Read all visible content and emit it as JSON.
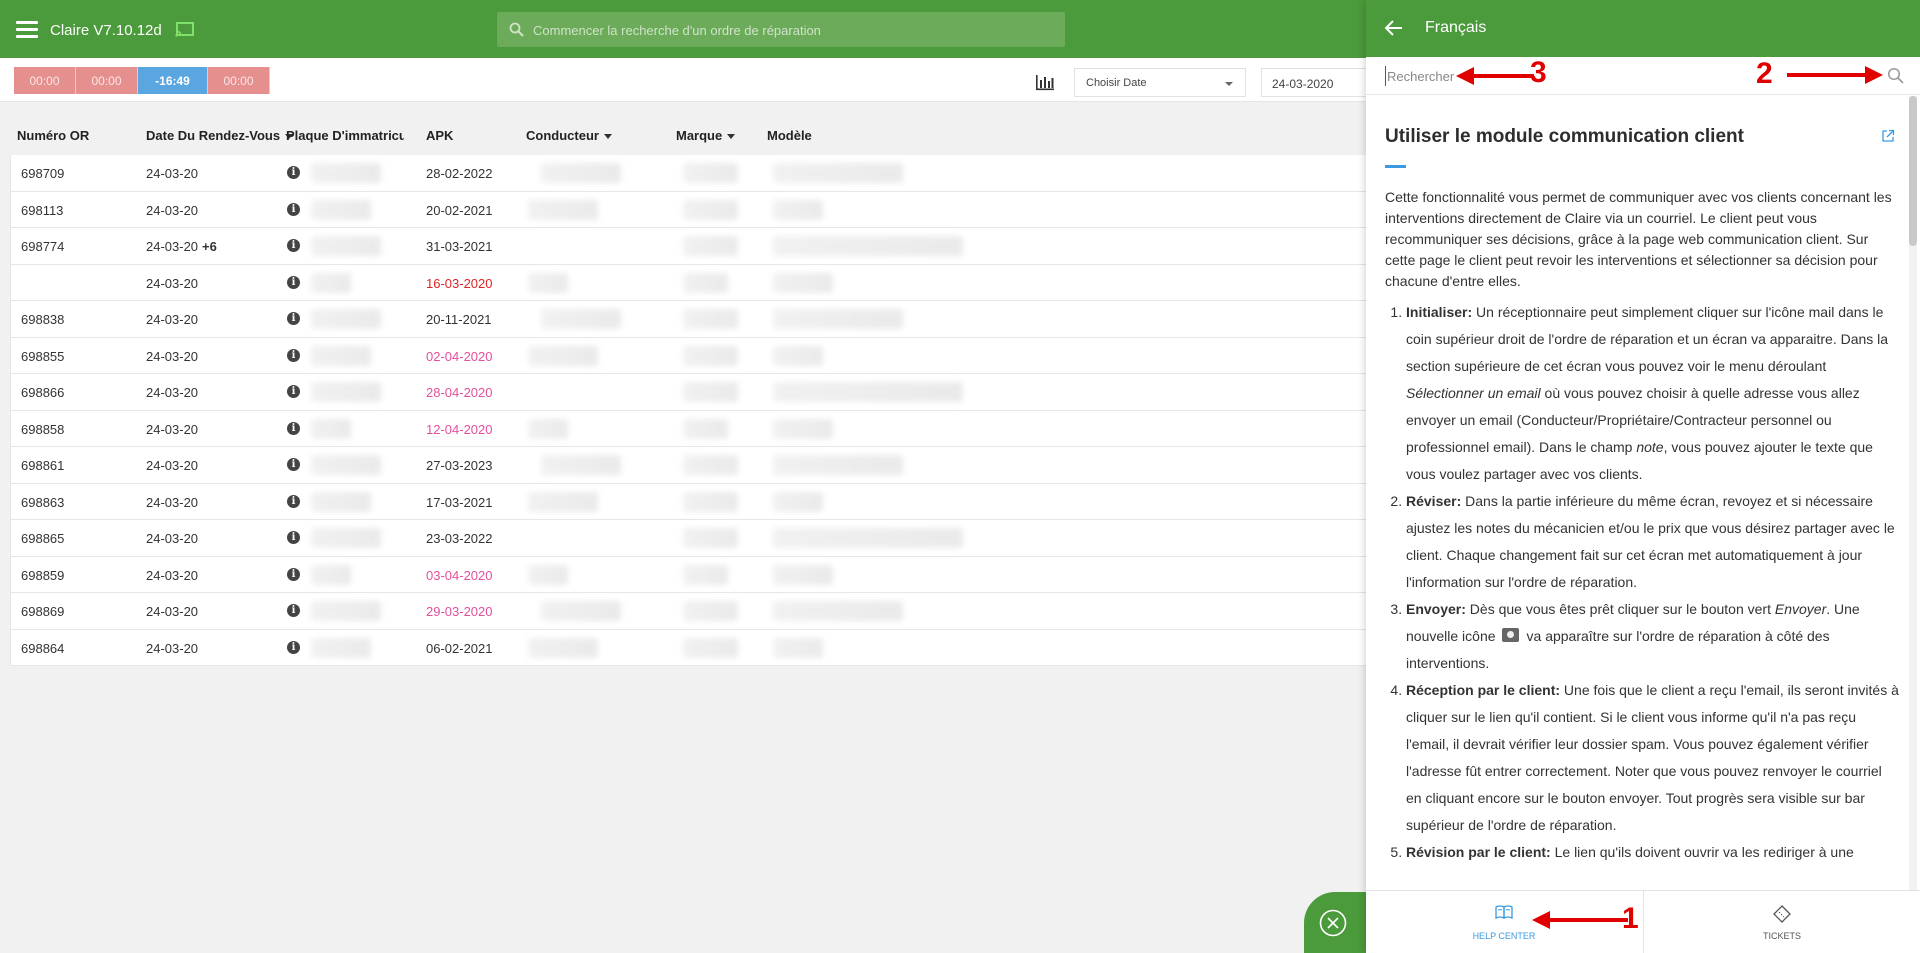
{
  "header": {
    "app_title": "Claire V7.10.12d",
    "search_placeholder": "Commencer la recherche d'un ordre de réparation"
  },
  "toolbar": {
    "timers": [
      "00:00",
      "00:00",
      "-16:49",
      "00:00"
    ],
    "date_select_label": "Choisir Date",
    "date_value": "24-03-2020"
  },
  "table": {
    "columns": [
      "Numéro OR",
      "Date Du Rendez-Vous",
      "Plaque D'immatriculation",
      "APK",
      "Conducteur",
      "Marque",
      "Modèle"
    ],
    "rows": [
      {
        "or": "698709",
        "date": "24-03-20",
        "extra": "",
        "apk": "28-02-2022",
        "apk_color": "normal"
      },
      {
        "or": "698113",
        "date": "24-03-20",
        "extra": "",
        "apk": "20-02-2021",
        "apk_color": "normal"
      },
      {
        "or": "698774",
        "date": "24-03-20",
        "extra": "+6",
        "apk": "31-03-2021",
        "apk_color": "normal"
      },
      {
        "or": "",
        "date": "24-03-20",
        "extra": "",
        "apk": "16-03-2020",
        "apk_color": "red"
      },
      {
        "or": "698838",
        "date": "24-03-20",
        "extra": "",
        "apk": "20-11-2021",
        "apk_color": "normal"
      },
      {
        "or": "698855",
        "date": "24-03-20",
        "extra": "",
        "apk": "02-04-2020",
        "apk_color": "pink"
      },
      {
        "or": "698866",
        "date": "24-03-20",
        "extra": "",
        "apk": "28-04-2020",
        "apk_color": "pink"
      },
      {
        "or": "698858",
        "date": "24-03-20",
        "extra": "",
        "apk": "12-04-2020",
        "apk_color": "pink"
      },
      {
        "or": "698861",
        "date": "24-03-20",
        "extra": "",
        "apk": "27-03-2023",
        "apk_color": "normal"
      },
      {
        "or": "698863",
        "date": "24-03-20",
        "extra": "",
        "apk": "17-03-2021",
        "apk_color": "normal"
      },
      {
        "or": "698865",
        "date": "24-03-20",
        "extra": "",
        "apk": "23-03-2022",
        "apk_color": "normal"
      },
      {
        "or": "698859",
        "date": "24-03-20",
        "extra": "",
        "apk": "03-04-2020",
        "apk_color": "pink"
      },
      {
        "or": "698869",
        "date": "24-03-20",
        "extra": "",
        "apk": "29-03-2020",
        "apk_color": "pink"
      },
      {
        "or": "698864",
        "date": "24-03-20",
        "extra": "",
        "apk": "06-02-2021",
        "apk_color": "normal"
      }
    ]
  },
  "help_panel": {
    "language": "Français",
    "search_placeholder": "Rechercher",
    "article_title": "Utiliser le module communication client",
    "intro": "Cette fonctionnalité vous permet de communiquer avec vos clients  concernant les interventions directement de Claire via un courriel. Le client peut vous recommuniquer ses décisions, grâce à la page web communication client. Sur cette page le client peut revoir les interventions et sélectionner sa décision pour chacune d'entre elles.",
    "steps": [
      {
        "title": "Initialiser:",
        "t1": " Un réceptionnaire peut simplement cliquer sur l'icône mail dans le coin supérieur droit de l'ordre de réparation et un écran va apparaitre. Dans la section supérieure de cet écran vous pouvez voir le menu déroulant ",
        "em1": "Sélectionner un email",
        "t2": " où vous pouvez choisir à quelle adresse vous allez envoyer un email (Conducteur/Propriétaire/Contracteur personnel ou professionnel email). Dans le champ ",
        "em2": "note",
        "t3": ", vous pouvez ajouter le texte que vous voulez partager avec vos clients."
      },
      {
        "title": "Réviser:",
        "t1": " Dans la partie inférieure du même écran, revoyez et si nécessaire ajustez les notes du mécanicien et/ou le prix que vous désirez partager avec le client. Chaque changement fait sur cet écran met automatiquement à jour l'information sur l'ordre de réparation."
      },
      {
        "title": "Envoyer:",
        "t1": " Dès que vous êtes prêt cliquer sur le bouton vert ",
        "em1": "Envoyer",
        "t2": ". Une nouvelle icône",
        "t3": "va apparaître sur l'ordre de réparation à côté des interventions."
      },
      {
        "title": "Réception par le client:",
        "t1": " Une fois que le client a reçu l'email, ils seront invités à cliquer sur le lien qu'il contient. Si le client vous informe qu'il n'a pas reçu l'email, il devrait vérifier leur dossier spam. Vous pouvez également vérifier l'adresse fût entrer correctement. Noter que vous pouvez renvoyer le courriel en cliquant encore sur le bouton envoyer. Tout progrès sera visible sur bar supérieur de l'ordre de réparation."
      },
      {
        "title": "Révision par le client:",
        "t1": " Le lien qu'ils doivent ouvrir va les rediriger à une"
      }
    ],
    "tabs": {
      "help": "HELP CENTER",
      "tickets": "TICKETS"
    }
  },
  "annotations": {
    "n1": "1",
    "n2": "2",
    "n3": "3"
  },
  "colors": {
    "brand_green": "#4b9a3b",
    "accent_blue": "#3b9ae0",
    "apk_red": "#e02424",
    "apk_pink": "#e54f9c",
    "annotation_red": "#e00000"
  }
}
